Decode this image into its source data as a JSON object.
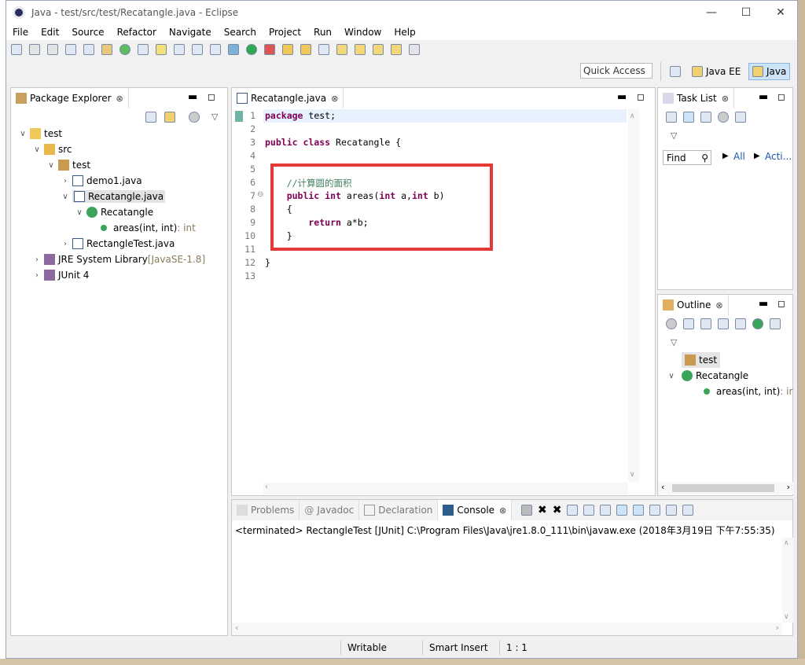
{
  "window": {
    "title": "Java - test/src/test/Recatangle.java - Eclipse"
  },
  "menu": [
    "File",
    "Edit",
    "Source",
    "Refactor",
    "Navigate",
    "Search",
    "Project",
    "Run",
    "Window",
    "Help"
  ],
  "quick_access": "Quick Access",
  "perspectives": {
    "java_ee": "Java EE",
    "java": "Java"
  },
  "package_explorer": {
    "tab": "Package Explorer",
    "tree": [
      {
        "label": "test",
        "extra": ""
      },
      {
        "label": "src",
        "extra": ""
      },
      {
        "label": "test",
        "extra": ""
      },
      {
        "label": "demo1.java",
        "extra": ""
      },
      {
        "label": "Recatangle.java",
        "extra": ""
      },
      {
        "label": "Recatangle",
        "extra": ""
      },
      {
        "label": "areas(int, int)",
        "extra": " : int"
      },
      {
        "label": "RectangleTest.java",
        "extra": ""
      },
      {
        "label": "JRE System Library",
        "extra": " [JavaSE-1.8]"
      },
      {
        "label": "JUnit 4",
        "extra": ""
      }
    ]
  },
  "editor": {
    "tab": "Recatangle.java",
    "lines": [
      {
        "n": "1",
        "k": "package",
        "t": " test;"
      },
      {
        "n": "2",
        "k": "",
        "t": ""
      },
      {
        "n": "3",
        "k": "public class",
        "t": " Recatangle {"
      },
      {
        "n": "4",
        "k": "",
        "t": ""
      },
      {
        "n": "5",
        "k": "",
        "t": ""
      },
      {
        "n": "6",
        "k": "",
        "t": "",
        "c": "    //计算圆的面积"
      },
      {
        "n": "7",
        "k": "    public int",
        "t": " areas(",
        "k2": "int",
        "t2": " a,",
        "k3": "int",
        "t3": " b)"
      },
      {
        "n": "8",
        "k": "",
        "t": "    {"
      },
      {
        "n": "9",
        "k": "        return",
        "t": " a*b;"
      },
      {
        "n": "10",
        "k": "",
        "t": "    }"
      },
      {
        "n": "11",
        "k": "",
        "t": ""
      },
      {
        "n": "12",
        "k": "",
        "t": "}"
      },
      {
        "n": "13",
        "k": "",
        "t": ""
      }
    ]
  },
  "task_list": {
    "tab": "Task List",
    "find": "Find",
    "all": "All",
    "acti": "Acti..."
  },
  "outline": {
    "tab": "Outline",
    "items": [
      {
        "label": "test",
        "extra": ""
      },
      {
        "label": "Recatangle",
        "extra": ""
      },
      {
        "label": "areas(int, int)",
        "extra": " : ir"
      }
    ]
  },
  "bottom_tabs": [
    "Problems",
    "Javadoc",
    "Declaration",
    "Console"
  ],
  "console_text": "<terminated> RectangleTest [JUnit] C:\\Program Files\\Java\\jre1.8.0_111\\bin\\javaw.exe (2018年3月19日 下午7:55:35)",
  "status": {
    "writable": "Writable",
    "insert": "Smart Insert",
    "pos": "1 : 1"
  },
  "colors": {
    "highlight_box": "#e53935",
    "keyword": "#7f0055",
    "comment": "#3f7f5f"
  }
}
